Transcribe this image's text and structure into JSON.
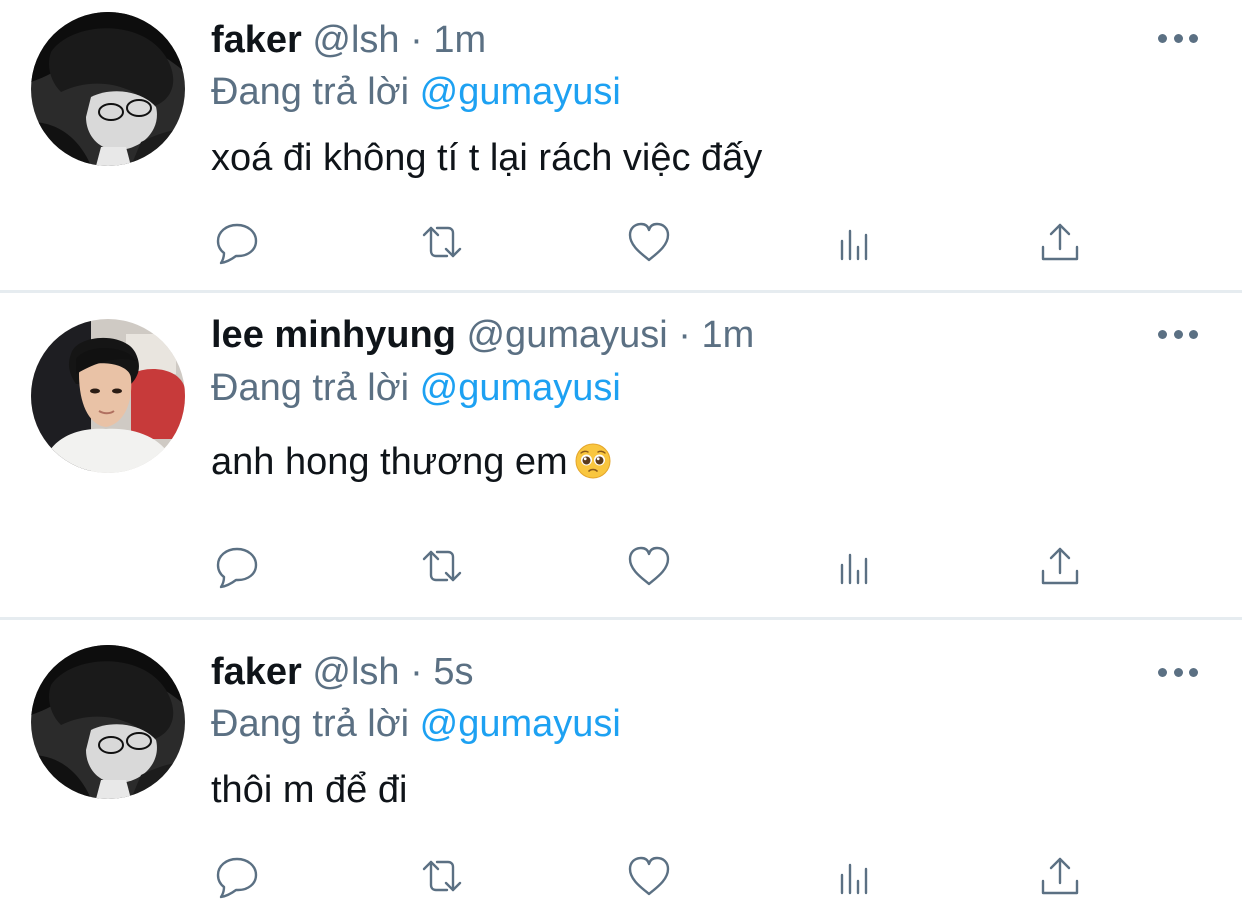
{
  "tweets": [
    {
      "display_name": "faker",
      "handle": "@lsh",
      "separator": "·",
      "time": "1m",
      "reply_prefix": "Đang trả lời",
      "reply_to": "@gumayusi",
      "text": "xoá đi không tí t lại rách việc đấy",
      "avatar_icon": "avatar-faker"
    },
    {
      "display_name": "lee minhyung",
      "handle": "@gumayusi",
      "separator": "·",
      "time": "1m",
      "reply_prefix": "Đang trả lời",
      "reply_to": "@gumayusi",
      "text": "anh hong thương em",
      "emoji_icon": "pleading-face-emoji",
      "avatar_icon": "avatar-lee-minhyung"
    },
    {
      "display_name": "faker",
      "handle": "@lsh",
      "separator": "·",
      "time": "5s",
      "reply_prefix": "Đang trả lời",
      "reply_to": "@gumayusi",
      "text": "thôi m để đi",
      "avatar_icon": "avatar-faker"
    }
  ],
  "action_icons": [
    "reply-icon",
    "retweet-icon",
    "like-icon",
    "analytics-icon",
    "share-icon"
  ],
  "colors": {
    "text": "#0f1419",
    "secondary": "#5b7083",
    "mention": "#1da1f2",
    "divider": "#e6ecf0"
  }
}
